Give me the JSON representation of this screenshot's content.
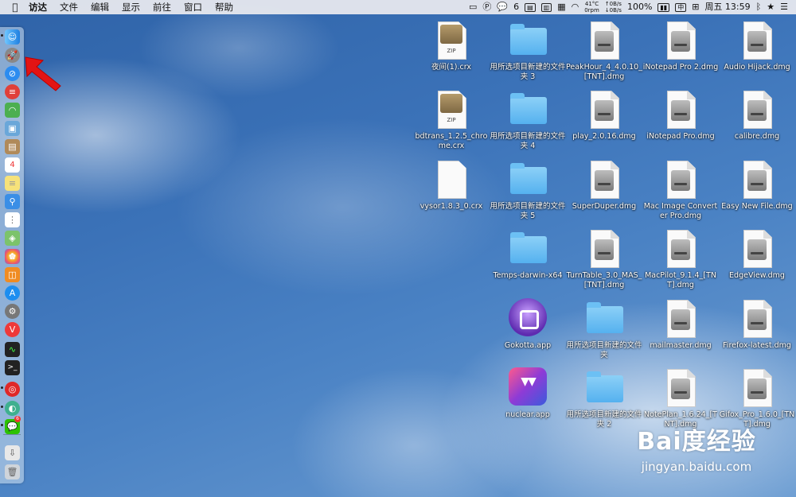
{
  "menubar": {
    "apple_icon": "apple-icon",
    "items": [
      "访达",
      "文件",
      "编辑",
      "显示",
      "前往",
      "窗口",
      "帮助"
    ]
  },
  "status": {
    "notification_count": "6",
    "temperature": "41°C",
    "fan": "0rpm",
    "net_up": "↑0B/s",
    "net_down": "↓0B/s",
    "battery": "100%",
    "input_method": "中",
    "clock": "周五 13:59"
  },
  "dock": {
    "icons": [
      "finder-icon",
      "launchpad-icon",
      "safari-icon",
      "app-red-icon",
      "android-icon",
      "preview-icon",
      "contacts-icon",
      "calendar-icon",
      "notes-icon",
      "search-people-icon",
      "reminders-icon",
      "maps-icon",
      "photos-icon",
      "books-icon",
      "app-store-icon",
      "system-preferences-icon",
      "vivaldi-icon",
      "activity-monitor-icon",
      "terminal-icon",
      "netease-music-icon",
      "chat-icon",
      "wechat-icon",
      "downloads-icon",
      "trash-icon"
    ],
    "calendar_day": "4",
    "badge": "6"
  },
  "desktop_icons": [
    {
      "label": "夜间(1).crx",
      "type": "zip"
    },
    {
      "label": "用所选项目新建的文件夹 3",
      "type": "folder"
    },
    {
      "label": "PeakHour_4_4.0.10_[TNT].dmg",
      "type": "dmg"
    },
    {
      "label": "iNotepad Pro 2.dmg",
      "type": "dmg"
    },
    {
      "label": "Audio Hijack.dmg",
      "type": "dmg"
    },
    {
      "label": "bdtrans_1.2.5_chrome.crx",
      "type": "zip"
    },
    {
      "label": "用所选项目新建的文件夹 4",
      "type": "folder"
    },
    {
      "label": "play_2.0.16.dmg",
      "type": "dmg"
    },
    {
      "label": "iNotepad Pro.dmg",
      "type": "dmg"
    },
    {
      "label": "calibre.dmg",
      "type": "dmg"
    },
    {
      "label": "vysor1.8.3_0.crx",
      "type": "doc"
    },
    {
      "label": "用所选项目新建的文件夹 5",
      "type": "folder"
    },
    {
      "label": "SuperDuper.dmg",
      "type": "dmg"
    },
    {
      "label": "Mac Image Converter Pro.dmg",
      "type": "dmg"
    },
    {
      "label": "Easy New File.dmg",
      "type": "dmg"
    },
    {
      "label": "Temps-darwin-x64",
      "type": "folder"
    },
    {
      "label": "TurnTable_3.0_MAS_[TNT].dmg",
      "type": "dmg"
    },
    {
      "label": "MacPilot_9.1.4_[TNT].dmg",
      "type": "dmg"
    },
    {
      "label": "EdgeView.dmg",
      "type": "dmg"
    },
    {
      "label": "Gokotta.app",
      "type": "gokotta"
    },
    {
      "label": "用所选项目新建的文件夹",
      "type": "folder"
    },
    {
      "label": "mailmaster.dmg",
      "type": "dmg"
    },
    {
      "label": "Firefox-latest.dmg",
      "type": "dmg"
    },
    {
      "label": "nuclear.app",
      "type": "nuclear"
    },
    {
      "label": "用所选项目新建的文件夹 2",
      "type": "folder"
    },
    {
      "label": "NotePlan_1.6.24_[TNT].dmg",
      "type": "dmg"
    },
    {
      "label": "Gifox_Pro_1.6.0_[TNT].dmg",
      "type": "dmg"
    }
  ],
  "zip_text": "ZIP",
  "watermark": {
    "logo": "Bai度经验",
    "url": "jingyan.baidu.com"
  },
  "colors": {
    "arrow": "#e31414"
  }
}
